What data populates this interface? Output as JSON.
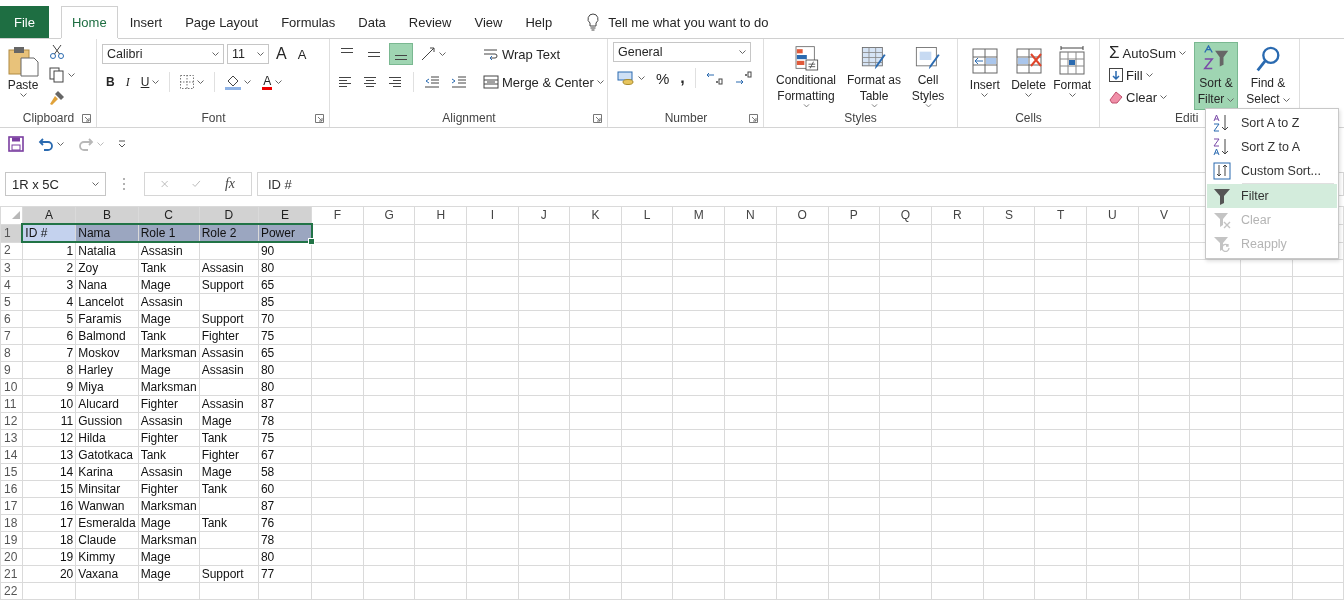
{
  "tabs": [
    {
      "label": "File",
      "kind": "file",
      "selected": false
    },
    {
      "label": "Home",
      "kind": "tab",
      "selected": true
    },
    {
      "label": "Insert",
      "kind": "tab",
      "selected": false
    },
    {
      "label": "Page Layout",
      "kind": "tab",
      "selected": false
    },
    {
      "label": "Formulas",
      "kind": "tab",
      "selected": false
    },
    {
      "label": "Data",
      "kind": "tab",
      "selected": false
    },
    {
      "label": "Review",
      "kind": "tab",
      "selected": false
    },
    {
      "label": "View",
      "kind": "tab",
      "selected": false
    },
    {
      "label": "Help",
      "kind": "tab",
      "selected": false
    }
  ],
  "tell_me": {
    "placeholder": "Tell me what you want to do"
  },
  "ribbon": {
    "clipboard": {
      "label": "Clipboard",
      "paste": "Paste"
    },
    "font": {
      "label": "Font",
      "font_name": "Calibri",
      "font_size": "11",
      "grow": "A",
      "shrink": "A",
      "bold": "B",
      "italic": "I",
      "underline": "U",
      "font_color": "A"
    },
    "alignment": {
      "label": "Alignment",
      "vertical": [
        {
          "selected": false
        },
        {
          "selected": false
        },
        {
          "selected": true
        }
      ],
      "wrap_text": "Wrap Text",
      "merge_center": "Merge & Center"
    },
    "number": {
      "label": "Number",
      "format": "General",
      "percent": "%",
      "comma": ","
    },
    "styles": {
      "label": "Styles",
      "buttons": [
        "Conditional Formatting",
        "Format as Table",
        "Cell Styles"
      ]
    },
    "cells": {
      "label": "Cells",
      "buttons": [
        "Insert",
        "Delete",
        "Format"
      ]
    },
    "editing": {
      "label": "Editi",
      "autosum_symbol": "Σ",
      "autosum": "AutoSum",
      "fill": "Fill",
      "clear": "Clear",
      "sort_filter": "Sort & Filter",
      "sort_filter_pressed": true,
      "find_select": "Find & Select"
    }
  },
  "quick_access": {
    "redo_disabled": true
  },
  "formula_bar": {
    "name_box": "1R x 5C",
    "function_label": "fx",
    "content": "ID #"
  },
  "sheet": {
    "columns": [
      {
        "label": "A",
        "selected": true,
        "kind": "numeric"
      },
      {
        "label": "B",
        "selected": true,
        "kind": "text"
      },
      {
        "label": "C",
        "selected": true,
        "kind": "text"
      },
      {
        "label": "D",
        "selected": true,
        "kind": "text"
      },
      {
        "label": "E",
        "selected": true,
        "kind": "text"
      },
      {
        "label": "F",
        "selected": false,
        "kind": "text"
      },
      {
        "label": "G",
        "selected": false,
        "kind": "text"
      },
      {
        "label": "H",
        "selected": false,
        "kind": "text"
      },
      {
        "label": "I",
        "selected": false,
        "kind": "text"
      },
      {
        "label": "J",
        "selected": false,
        "kind": "text"
      },
      {
        "label": "K",
        "selected": false,
        "kind": "text"
      },
      {
        "label": "L",
        "selected": false,
        "kind": "text"
      },
      {
        "label": "M",
        "selected": false,
        "kind": "text"
      },
      {
        "label": "N",
        "selected": false,
        "kind": "text"
      },
      {
        "label": "O",
        "selected": false,
        "kind": "text"
      },
      {
        "label": "P",
        "selected": false,
        "kind": "text"
      },
      {
        "label": "Q",
        "selected": false,
        "kind": "text"
      },
      {
        "label": "R",
        "selected": false,
        "kind": "text"
      },
      {
        "label": "S",
        "selected": false,
        "kind": "text"
      },
      {
        "label": "T",
        "selected": false,
        "kind": "text"
      },
      {
        "label": "U",
        "selected": false,
        "kind": "text"
      },
      {
        "label": "V",
        "selected": false,
        "kind": "text"
      }
    ],
    "rows": [
      {
        "number": "1",
        "kind": "header",
        "selected": true,
        "cells": [
          "ID #",
          "Nama",
          "Role 1",
          "Role 2",
          "Power"
        ]
      },
      {
        "number": "2",
        "kind": "data",
        "selected": false,
        "cells": [
          "1",
          "Natalia",
          "Assasin",
          "",
          "90"
        ]
      },
      {
        "number": "3",
        "kind": "data",
        "selected": false,
        "cells": [
          "2",
          "Zoy",
          "Tank",
          "Assasin",
          "80"
        ]
      },
      {
        "number": "4",
        "kind": "data",
        "selected": false,
        "cells": [
          "3",
          "Nana",
          "Mage",
          "Support",
          "65"
        ]
      },
      {
        "number": "5",
        "kind": "data",
        "selected": false,
        "cells": [
          "4",
          "Lancelot",
          "Assasin",
          "",
          "85"
        ]
      },
      {
        "number": "6",
        "kind": "data",
        "selected": false,
        "cells": [
          "5",
          "Faramis",
          "Mage",
          "Support",
          "70"
        ]
      },
      {
        "number": "7",
        "kind": "data",
        "selected": false,
        "cells": [
          "6",
          "Balmond",
          "Tank",
          "Fighter",
          "75"
        ]
      },
      {
        "number": "8",
        "kind": "data",
        "selected": false,
        "cells": [
          "7",
          "Moskov",
          "Marksman",
          "Assasin",
          "65"
        ]
      },
      {
        "number": "9",
        "kind": "data",
        "selected": false,
        "cells": [
          "8",
          "Harley",
          "Mage",
          "Assasin",
          "80"
        ]
      },
      {
        "number": "10",
        "kind": "data",
        "selected": false,
        "cells": [
          "9",
          "Miya",
          "Marksman",
          "",
          "80"
        ]
      },
      {
        "number": "11",
        "kind": "data",
        "selected": false,
        "cells": [
          "10",
          "Alucard",
          "Fighter",
          "Assasin",
          "87"
        ]
      },
      {
        "number": "12",
        "kind": "data",
        "selected": false,
        "cells": [
          "11",
          "Gussion",
          "Assasin",
          "Mage",
          "78"
        ]
      },
      {
        "number": "13",
        "kind": "data",
        "selected": false,
        "cells": [
          "12",
          "Hilda",
          "Fighter",
          "Tank",
          "75"
        ]
      },
      {
        "number": "14",
        "kind": "data",
        "selected": false,
        "cells": [
          "13",
          "Gatotkaca",
          "Tank",
          "Fighter",
          "67"
        ]
      },
      {
        "number": "15",
        "kind": "data",
        "selected": false,
        "cells": [
          "14",
          "Karina",
          "Assasin",
          "Mage",
          "58"
        ]
      },
      {
        "number": "16",
        "kind": "data",
        "selected": false,
        "cells": [
          "15",
          "Minsitar",
          "Fighter",
          "Tank",
          "60"
        ]
      },
      {
        "number": "17",
        "kind": "data",
        "selected": false,
        "cells": [
          "16",
          "Wanwan",
          "Marksman",
          "",
          "87"
        ]
      },
      {
        "number": "18",
        "kind": "data",
        "selected": false,
        "cells": [
          "17",
          "Esmeralda",
          "Mage",
          "Tank",
          "76"
        ]
      },
      {
        "number": "19",
        "kind": "data",
        "selected": false,
        "cells": [
          "18",
          "Claude",
          "Marksman",
          "",
          "78"
        ]
      },
      {
        "number": "20",
        "kind": "data",
        "selected": false,
        "cells": [
          "19",
          "Kimmy",
          "Mage",
          "",
          "80"
        ]
      },
      {
        "number": "21",
        "kind": "data",
        "selected": false,
        "cells": [
          "20",
          "Vaxana",
          "Mage",
          "Support",
          "77"
        ]
      },
      {
        "number": "22",
        "kind": "data",
        "selected": false,
        "cells": []
      }
    ]
  },
  "menu": {
    "items": [
      {
        "label": "Sort A to Z",
        "kind": "sort-az",
        "selected": false,
        "disabled": false
      },
      {
        "label": "Sort Z to A",
        "kind": "sort-za",
        "selected": false,
        "disabled": false
      },
      {
        "label": "Custom Sort...",
        "kind": "custom-sort",
        "selected": false,
        "disabled": false
      },
      {
        "label": "Filter",
        "kind": "filter",
        "selected": true,
        "disabled": false
      },
      {
        "label": "Clear",
        "kind": "clear",
        "selected": false,
        "disabled": true
      },
      {
        "label": "Reapply",
        "kind": "reapply",
        "selected": false,
        "disabled": true
      }
    ]
  }
}
